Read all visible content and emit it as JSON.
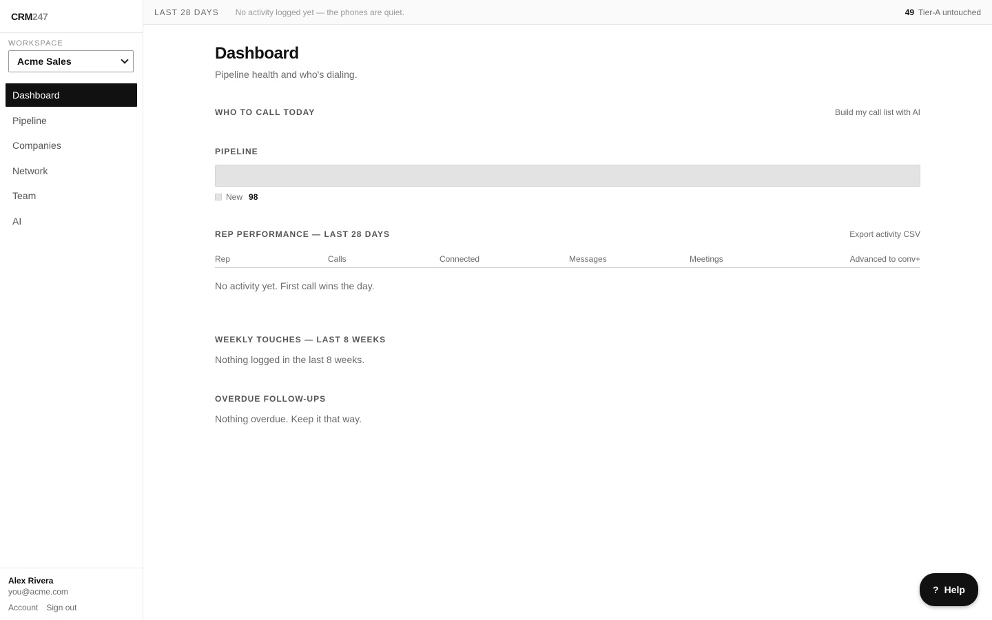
{
  "brand": {
    "part1": "CRM",
    "part2": "247"
  },
  "workspace": {
    "label": "WORKSPACE",
    "selected": "Acme Sales"
  },
  "sidebar": {
    "items": [
      {
        "label": "Dashboard",
        "active": true
      },
      {
        "label": "Pipeline"
      },
      {
        "label": "Companies"
      },
      {
        "label": "Network"
      },
      {
        "label": "Team"
      },
      {
        "label": "AI"
      }
    ]
  },
  "user": {
    "name": "Alex Rivera",
    "email": "you@acme.com",
    "account_link": "Account",
    "signout_link": "Sign out"
  },
  "topbar": {
    "range": "LAST 28 DAYS",
    "message": "No activity logged yet — the phones are quiet.",
    "tier_count": "49",
    "tier_label": "Tier-A untouched"
  },
  "page": {
    "title": "Dashboard",
    "subtitle": "Pipeline health and who's dialing."
  },
  "call_today": {
    "title": "WHO TO CALL TODAY",
    "action": "Build my call list with AI"
  },
  "pipeline": {
    "title": "PIPELINE",
    "stages": [
      {
        "name": "New",
        "count": "98",
        "fraction": 1.0,
        "color": "#e3e3e3"
      }
    ]
  },
  "rep_performance": {
    "title": "REP PERFORMANCE — LAST 28 DAYS",
    "action": "Export activity CSV",
    "columns": [
      "Rep",
      "Calls",
      "Connected",
      "Messages",
      "Meetings",
      "Advanced to conv+"
    ],
    "empty": "No activity yet. First call wins the day."
  },
  "weekly": {
    "title": "WEEKLY TOUCHES — LAST 8 WEEKS",
    "empty": "Nothing logged in the last 8 weeks."
  },
  "overdue": {
    "title": "OVERDUE FOLLOW-UPS",
    "empty": "Nothing overdue. Keep it that way."
  },
  "help": {
    "icon": "?",
    "label": "Help"
  }
}
